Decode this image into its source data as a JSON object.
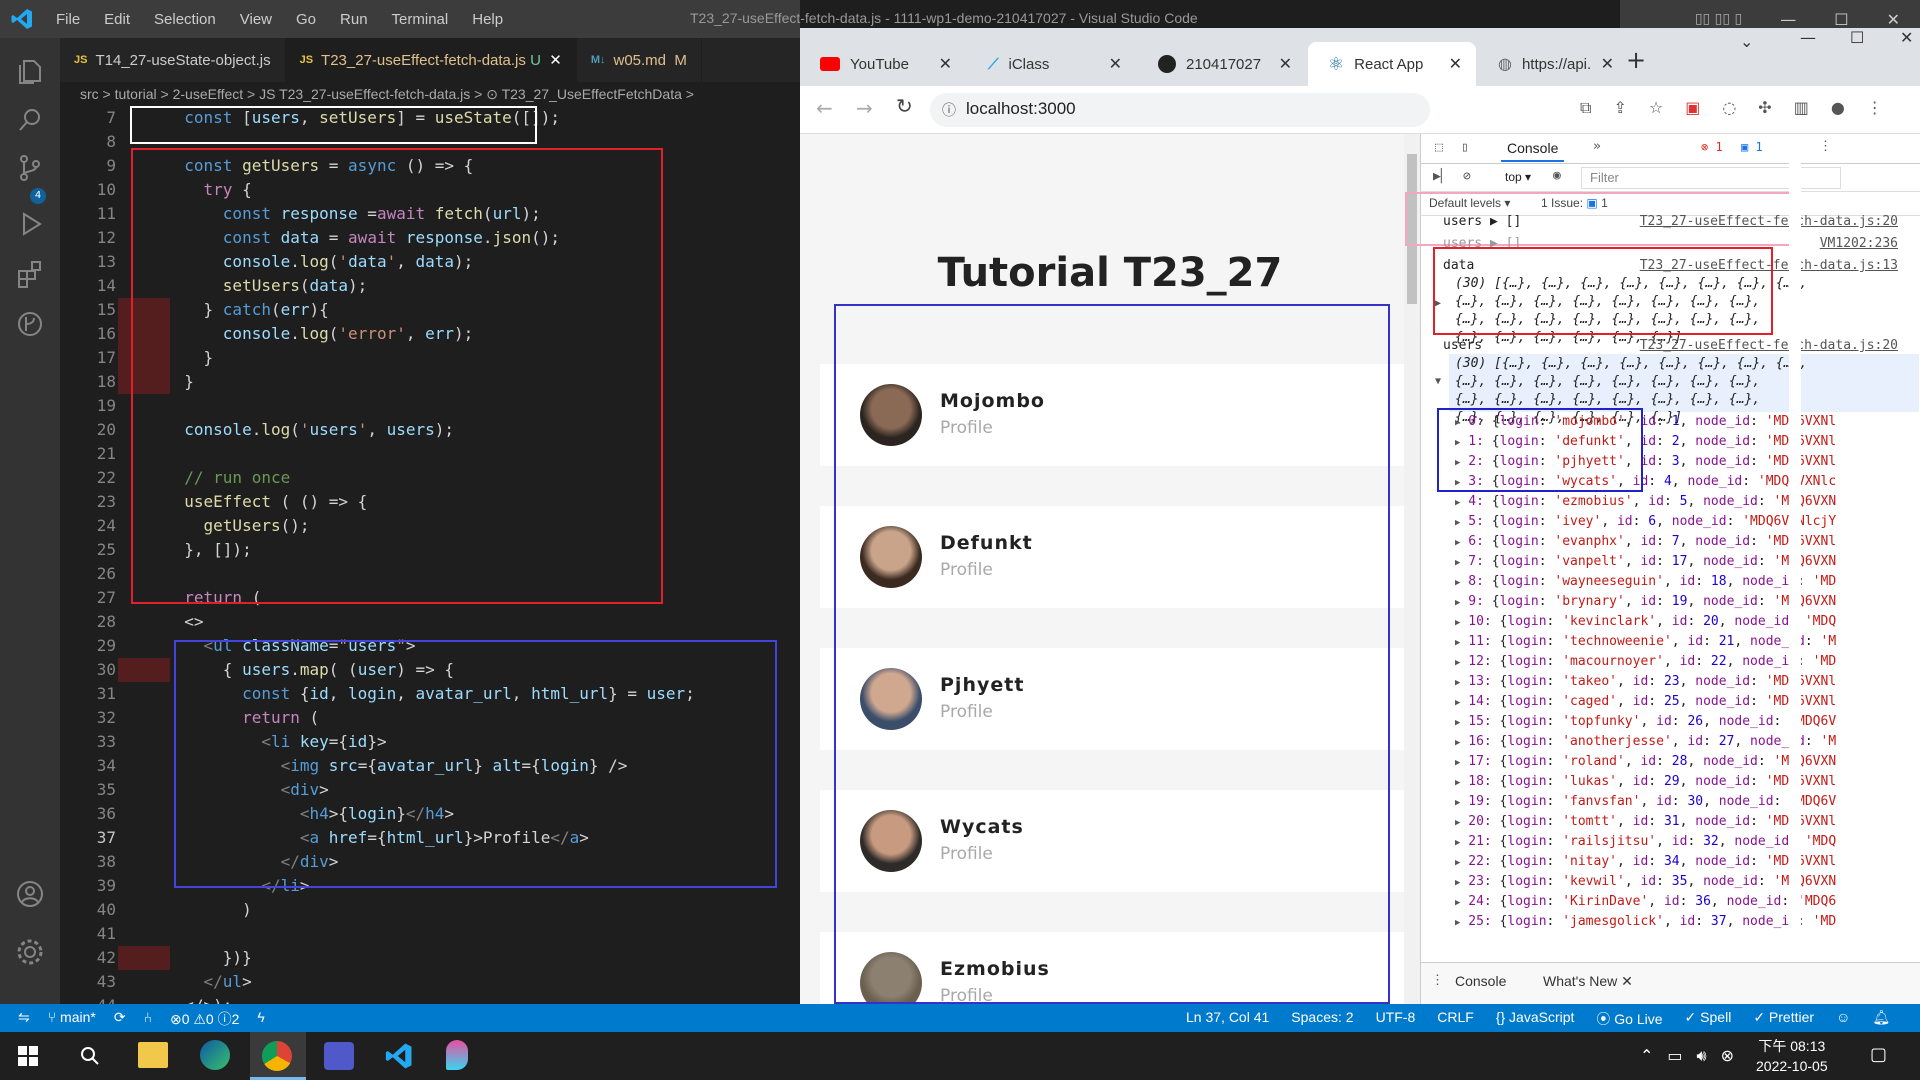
{
  "vscode": {
    "menu": [
      "File",
      "Edit",
      "Selection",
      "View",
      "Go",
      "Run",
      "Terminal",
      "Help"
    ],
    "window_title": "T23_27-useEffect-fetch-data.js - 1111-wp1-demo-210417027 - Visual Studio Code",
    "tabs": [
      {
        "label": "T14_27-useState-object.js",
        "badge": ""
      },
      {
        "label": "T23_27-useEffect-fetch-data.js",
        "badge": "U"
      },
      {
        "label": "w05.md",
        "badge": "M"
      }
    ],
    "breadcrumb": "src > tutorial > 2-useEffect > JS T23_27-useEffect-fetch-data.js > ⊙ T23_27_UseEffectFetchData >",
    "source_control_badge": "4",
    "lines": [
      {
        "n": "7",
        "t": "  const [users, setUsers] = useState([]);"
      },
      {
        "n": "8",
        "t": ""
      },
      {
        "n": "9",
        "t": "  const getUsers = async () => {"
      },
      {
        "n": "10",
        "t": "    try {"
      },
      {
        "n": "11",
        "t": "      const response =await fetch(url);"
      },
      {
        "n": "12",
        "t": "      const data = await response.json();"
      },
      {
        "n": "13",
        "t": "      console.log('data', data);"
      },
      {
        "n": "14",
        "t": "      setUsers(data);"
      },
      {
        "n": "15",
        "t": "    } catch(err){"
      },
      {
        "n": "16",
        "t": "      console.log('error', err);"
      },
      {
        "n": "17",
        "t": "    }"
      },
      {
        "n": "18",
        "t": "  }"
      },
      {
        "n": "19",
        "t": ""
      },
      {
        "n": "20",
        "t": "  console.log('users', users);"
      },
      {
        "n": "21",
        "t": ""
      },
      {
        "n": "22",
        "t": "  // run once"
      },
      {
        "n": "23",
        "t": "  useEffect ( () => {"
      },
      {
        "n": "24",
        "t": "    getUsers();"
      },
      {
        "n": "25",
        "t": "  }, []);"
      },
      {
        "n": "26",
        "t": ""
      },
      {
        "n": "27",
        "t": "  return ("
      },
      {
        "n": "28",
        "t": "  <>"
      },
      {
        "n": "29",
        "t": "    <ul className=\"users\">"
      },
      {
        "n": "30",
        "t": "      { users.map( (user) => {"
      },
      {
        "n": "31",
        "t": "        const {id, login, avatar_url, html_url} = user;"
      },
      {
        "n": "32",
        "t": "        return ("
      },
      {
        "n": "33",
        "t": "          <li key={id}>"
      },
      {
        "n": "34",
        "t": "            <img src={avatar_url} alt={login} />"
      },
      {
        "n": "35",
        "t": "            <div>"
      },
      {
        "n": "36",
        "t": "              <h4>{login}</h4>"
      },
      {
        "n": "37",
        "t": "              <a href={html_url}>Profile</a>"
      },
      {
        "n": "38",
        "t": "            </div>"
      },
      {
        "n": "39",
        "t": "          </li>"
      },
      {
        "n": "40",
        "t": "        )"
      },
      {
        "n": "41",
        "t": ""
      },
      {
        "n": "42",
        "t": "      })}"
      },
      {
        "n": "43",
        "t": "    </ul>"
      },
      {
        "n": "44",
        "t": "  </>);"
      }
    ],
    "status": {
      "branch": "main*",
      "problems": "⊗0 ⚠0 ⓘ2",
      "position": "Ln 37, Col 41",
      "spaces": "Spaces: 2",
      "encoding": "UTF-8",
      "eol": "CRLF",
      "language": "{} JavaScript",
      "golive": "Go Live",
      "spell": "✓ Spell",
      "prettier": "✓ Prettier"
    }
  },
  "chrome": {
    "tabs": [
      {
        "label": "YouTube",
        "color": "#ff0000"
      },
      {
        "label": "iClass",
        "color": "#29a9e0"
      },
      {
        "label": "210417027",
        "color": "#222"
      },
      {
        "label": "React App",
        "color": "#61dafb"
      },
      {
        "label": "https://api.",
        "color": "#666"
      }
    ],
    "url": "localhost:3000",
    "page": {
      "title": "Tutorial T23_27",
      "users": [
        {
          "login": "Mojombo",
          "link": "Profile",
          "skin": "#8a6a55",
          "hair": "#2b2420"
        },
        {
          "login": "Defunkt",
          "link": "Profile",
          "skin": "#c9a48a",
          "hair": "#3b2a20"
        },
        {
          "login": "Pjhyett",
          "link": "Profile",
          "skin": "#d0a890",
          "hair": "#3a4d6a"
        },
        {
          "login": "Wycats",
          "link": "Profile",
          "skin": "#c89a80",
          "hair": "#2e2a28"
        },
        {
          "login": "Ezmobius",
          "link": "Profile",
          "skin": "#8c8070",
          "hair": "#6b6050"
        }
      ]
    },
    "devtools": {
      "tab": "Console",
      "errors": "1",
      "messages": "1",
      "context": "top",
      "filter_placeholder": "Filter",
      "levels": "Default levels",
      "issues": "1 Issue:",
      "issues_count": "1",
      "log1": {
        "label": "users",
        "value": "▶ []",
        "src": "T23_27-useEffect-fetch-data.js:20"
      },
      "log2": {
        "label": "users",
        "value": "▶ []",
        "src": "VM1202:236"
      },
      "log3": {
        "label": "data",
        "src": "T23_27-useEffect-fetch-data.js:13",
        "lines": [
          "(30) [{…}, {…}, {…}, {…}, {…}, {…}, {…}, {…},",
          "{…}, {…}, {…}, {…}, {…}, {…}, {…}, {…},",
          "{…}, {…}, {…}, {…}, {…}, {…}, {…}, {…},",
          "{…}, {…}, {…}, {…}, {…}, {…}]"
        ]
      },
      "log4": {
        "label": "users",
        "src": "T23_27-useEffect-fetch-data.js:20",
        "lines": [
          "(30) [{…}, {…}, {…}, {…}, {…}, {…}, {…}, {…},",
          "{…}, {…}, {…}, {…}, {…}, {…}, {…}, {…},",
          "{…}, {…}, {…}, {…}, {…}, {…}, {…}, {…},",
          "{…}, {…}, {…}, {…}, {…}, {…}]"
        ]
      },
      "entries": [
        {
          "i": "0",
          "login": "mojombo",
          "id": "1",
          "nid": "'MDQ6VXNl"
        },
        {
          "i": "1",
          "login": "defunkt",
          "id": "2",
          "nid": "'MDQ6VXNl"
        },
        {
          "i": "2",
          "login": "pjhyett",
          "id": "3",
          "nid": "'MDQ6VXNl"
        },
        {
          "i": "3",
          "login": "wycats",
          "id": "4",
          "nid": "'MDQ6VXNlc"
        },
        {
          "i": "4",
          "login": "ezmobius",
          "id": "5",
          "nid": "'MDQ6VXN"
        },
        {
          "i": "5",
          "login": "ivey",
          "id": "6",
          "nid": "'MDQ6VXNlcjY"
        },
        {
          "i": "6",
          "login": "evanphx",
          "id": "7",
          "nid": "'MDQ6VXNl"
        },
        {
          "i": "7",
          "login": "vanpelt",
          "id": "17",
          "nid": "'MDQ6VXN"
        },
        {
          "i": "8",
          "login": "wayneeseguin",
          "id": "18",
          "nid": "'MD"
        },
        {
          "i": "9",
          "login": "brynary",
          "id": "19",
          "nid": "'MDQ6VXN"
        },
        {
          "i": "10",
          "login": "kevinclark",
          "id": "20",
          "nid": "'MDQ"
        },
        {
          "i": "11",
          "login": "technoweenie",
          "id": "21",
          "nid": "'M"
        },
        {
          "i": "12",
          "login": "macournoyer",
          "id": "22",
          "nid": "'MD"
        },
        {
          "i": "13",
          "login": "takeo",
          "id": "23",
          "nid": "'MDQ6VXNl"
        },
        {
          "i": "14",
          "login": "caged",
          "id": "25",
          "nid": "'MDQ6VXNl"
        },
        {
          "i": "15",
          "login": "topfunky",
          "id": "26",
          "nid": "'MDQ6V"
        },
        {
          "i": "16",
          "login": "anotherjesse",
          "id": "27",
          "nid": "'M"
        },
        {
          "i": "17",
          "login": "roland",
          "id": "28",
          "nid": "'MDQ6VXN"
        },
        {
          "i": "18",
          "login": "lukas",
          "id": "29",
          "nid": "'MDQ6VXNl"
        },
        {
          "i": "19",
          "login": "fanvsfan",
          "id": "30",
          "nid": "'MDQ6V"
        },
        {
          "i": "20",
          "login": "tomtt",
          "id": "31",
          "nid": "'MDQ6VXNl"
        },
        {
          "i": "21",
          "login": "railsjitsu",
          "id": "32",
          "nid": "'MDQ"
        },
        {
          "i": "22",
          "login": "nitay",
          "id": "34",
          "nid": "'MDQ6VXNl"
        },
        {
          "i": "23",
          "login": "kevwil",
          "id": "35",
          "nid": "'MDQ6VXN"
        },
        {
          "i": "24",
          "login": "KirinDave",
          "id": "36",
          "nid": "'MDQ6"
        },
        {
          "i": "25",
          "login": "jamesgolick",
          "id": "37",
          "nid": "'MD"
        }
      ],
      "drawer": [
        "Console",
        "What's New"
      ]
    }
  },
  "taskbar": {
    "time": "下午 08:13",
    "date": "2022-10-05"
  }
}
